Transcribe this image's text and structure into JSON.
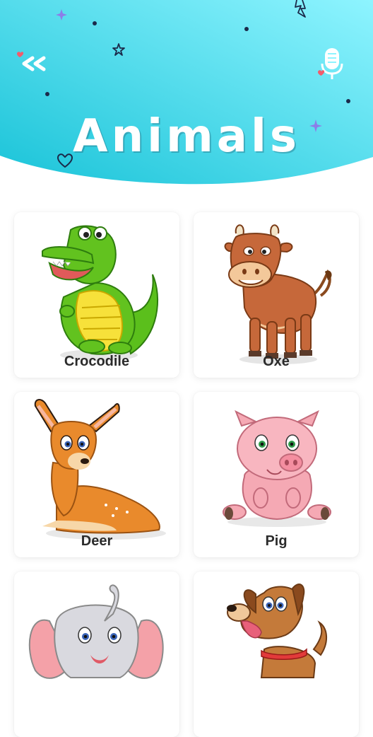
{
  "header": {
    "title": "Animals",
    "back_icon": "double-chevron-left-icon",
    "mic_icon": "microphone-icon",
    "gradient": [
      "#19c3d8",
      "#8ef4ff"
    ]
  },
  "animals": [
    {
      "label": "Crocodile",
      "icon": "crocodile-illustration"
    },
    {
      "label": "Oxe",
      "icon": "ox-illustration"
    },
    {
      "label": "Deer",
      "icon": "deer-illustration"
    },
    {
      "label": "Pig",
      "icon": "pig-illustration"
    },
    {
      "label": "",
      "icon": "elephant-illustration"
    },
    {
      "label": "",
      "icon": "dog-illustration"
    }
  ]
}
